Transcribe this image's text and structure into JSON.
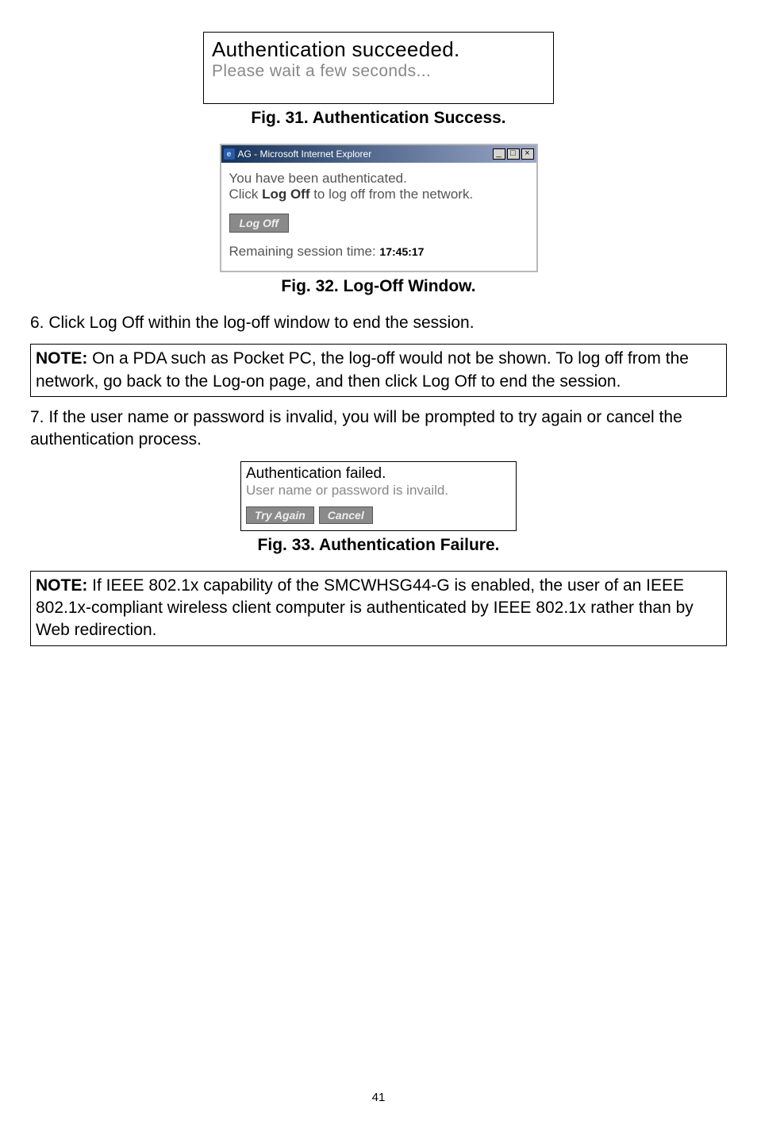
{
  "fig31": {
    "title": "Authentication succeeded.",
    "subtitle": "Please wait a few seconds...",
    "caption": "Fig. 31. Authentication Success."
  },
  "fig32": {
    "window_title": "AG - Microsoft Internet Explorer",
    "line1": "You have been authenticated.",
    "line2a": "Click ",
    "line2_bold": "Log Off",
    "line2b": " to log off from the network.",
    "button": "Log Off",
    "session_label": "Remaining session time: ",
    "session_time": "17:45:17",
    "caption": "Fig. 32. Log-Off Window."
  },
  "step6": "6.  Click Log Off within the log-off window to end the session.",
  "note1_label": "NOTE:",
  "note1_text": " On a PDA such as Pocket PC, the log-off would not be shown. To log off from the network, go back to the Log-on page, and then click Log Off to end the session.",
  "step7": "7.  If the user name or password is invalid, you will be prompted to try again or cancel the authentication process.",
  "fig33": {
    "title": "Authentication failed.",
    "subtitle": "User name or password is invaild.",
    "try_again": "Try Again",
    "cancel": "Cancel",
    "caption": "Fig. 33. Authentication Failure."
  },
  "note2_label": "NOTE:",
  "note2_text": " If IEEE 802.1x capability of the SMCWHSG44-G is enabled, the user of an IEEE 802.1x-compliant wireless client computer is authenticated by IEEE 802.1x rather than by Web redirection.",
  "page_number": "41"
}
